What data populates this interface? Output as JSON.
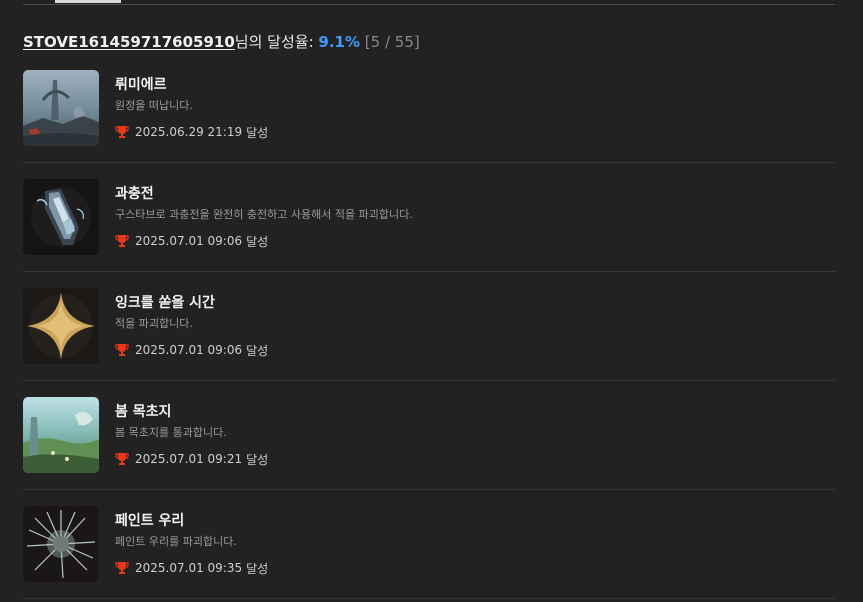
{
  "header": {
    "username": "STOVE161459717605910",
    "suffix": "님의 달성율:",
    "rate": "9.1%",
    "count": "[5 / 55]"
  },
  "colors": {
    "background": "#222222",
    "accent_rate": "#3a9cff",
    "trophy": "#e8391a"
  },
  "achievements": [
    {
      "title": "뤼미에르",
      "description": "원정을 떠납니다.",
      "date": "2025.06.29 21:19",
      "achieved_label": "달성",
      "icon": "lumiere-city-icon"
    },
    {
      "title": "과충전",
      "description": "구스타브로 과충전을 완전히 충전하고 사용해서 적을 파괴합니다.",
      "date": "2025.07.01 09:06",
      "achieved_label": "달성",
      "icon": "overcharge-gauntlet-icon"
    },
    {
      "title": "잉크를 쏟을 시간",
      "description": "적을 파괴합니다.",
      "date": "2025.07.01 09:06",
      "achieved_label": "달성",
      "icon": "gold-star-icon"
    },
    {
      "title": "봄 목초지",
      "description": "봄 목초지를 통과합니다.",
      "date": "2025.07.01 09:21",
      "achieved_label": "달성",
      "icon": "spring-meadow-icon"
    },
    {
      "title": "페인트 우리",
      "description": "페인트 우리를 파괴합니다.",
      "date": "2025.07.01 09:35",
      "achieved_label": "달성",
      "icon": "paint-cage-icon"
    }
  ]
}
